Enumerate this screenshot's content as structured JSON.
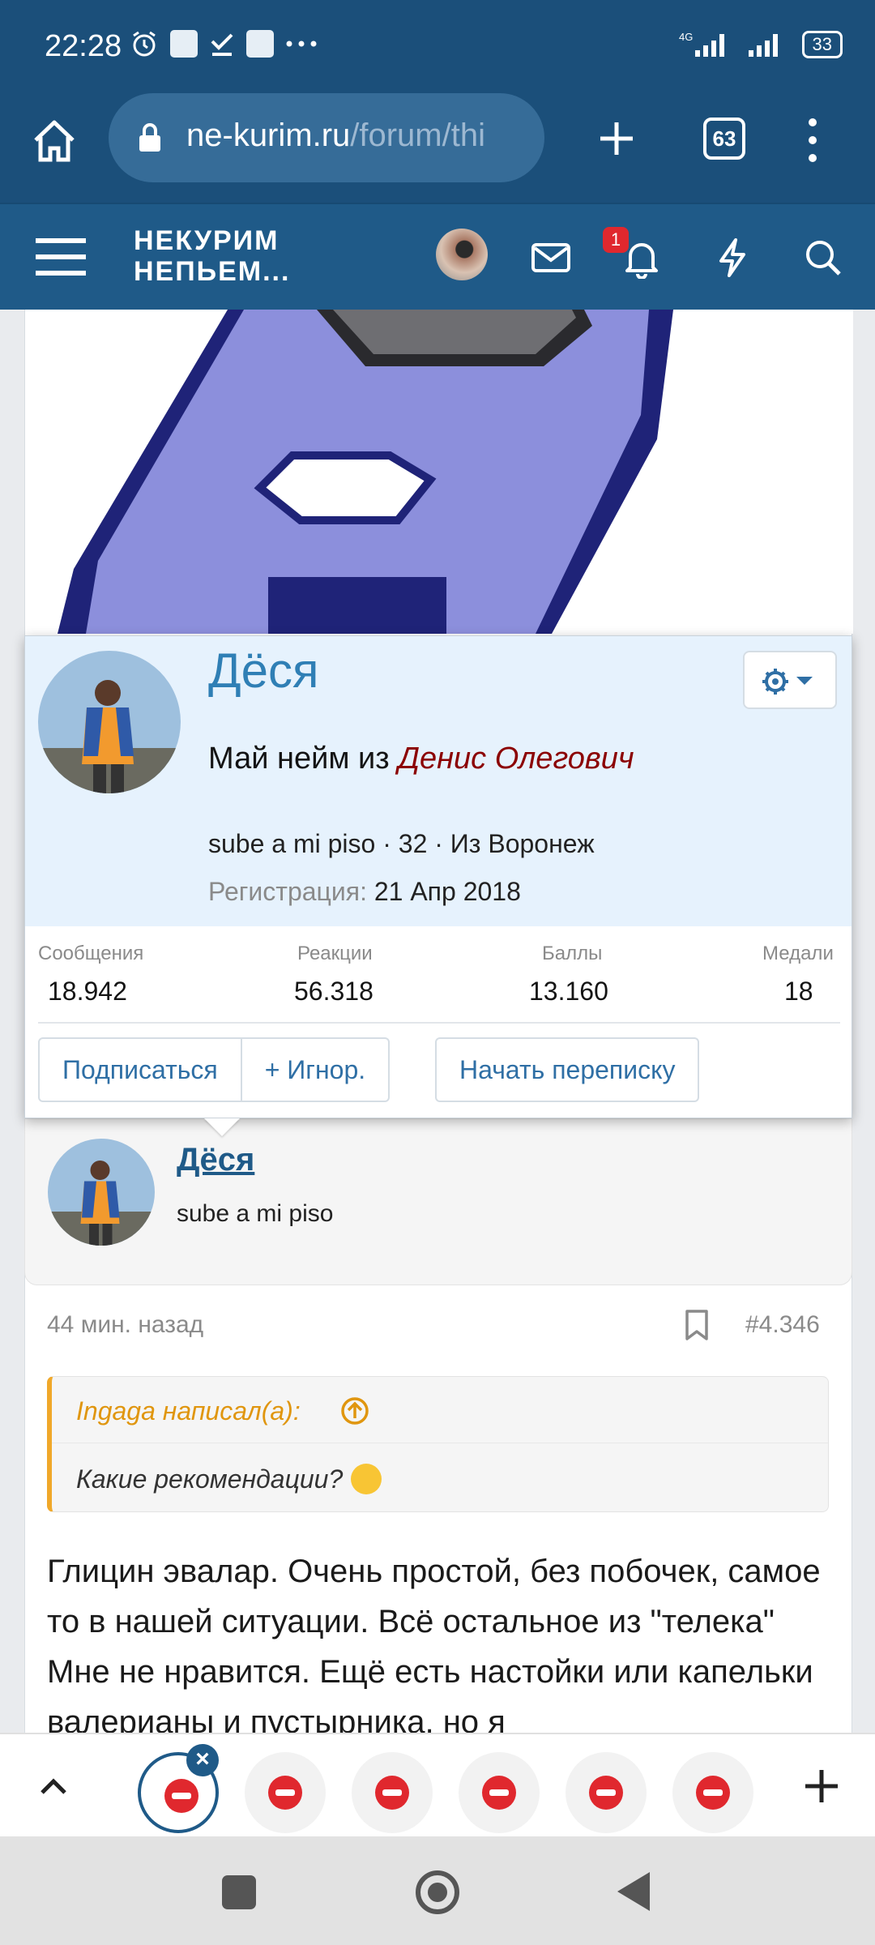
{
  "status": {
    "time": "22:28",
    "network": "4G",
    "battery": "33"
  },
  "browser": {
    "url_host": "ne-kurim.ru",
    "url_path": "/forum/thi",
    "tab_count": "63"
  },
  "site": {
    "logo_line1": "НЕКУРИМ",
    "logo_line2": "НЕПЬЕМ...",
    "notification_count": "1"
  },
  "profile_popup": {
    "name": "Дёся",
    "title_prefix": "Май нейм из",
    "title_name": "Денис Олегович",
    "meta": "sube a mi piso · 32 · Из Воронеж",
    "registration_label": "Регистрация:",
    "registration_date": "21 Апр 2018",
    "stats": [
      {
        "label": "Сообщения",
        "value": "18.942"
      },
      {
        "label": "Реакции",
        "value": "56.318"
      },
      {
        "label": "Баллы",
        "value": "13.160"
      },
      {
        "label": "Медали",
        "value": "18"
      }
    ],
    "buttons": {
      "subscribe": "Подписаться",
      "ignore": "+ Игнор.",
      "message": "Начать переписку"
    }
  },
  "post": {
    "author": "Дёся",
    "author_title": "sube a mi piso",
    "time": "44 мин. назад",
    "number": "#4.346",
    "quote_author": "Ingaga написал(а):",
    "quote_text": "Какие рекомендации?",
    "text": "Глицин эвалар. Очень простой, без побочек, самое то в нашей ситуации. Всё остальное из \"телека\" Мне не нравится. Ещё есть настойки или капельки валерианы и пустырника, но я"
  },
  "colors": {
    "header": "#1f5a88",
    "status_bar": "#1b4f7a",
    "link": "#2f7fb5",
    "quote_accent": "#f0a82a",
    "title_red": "#8b0000"
  }
}
